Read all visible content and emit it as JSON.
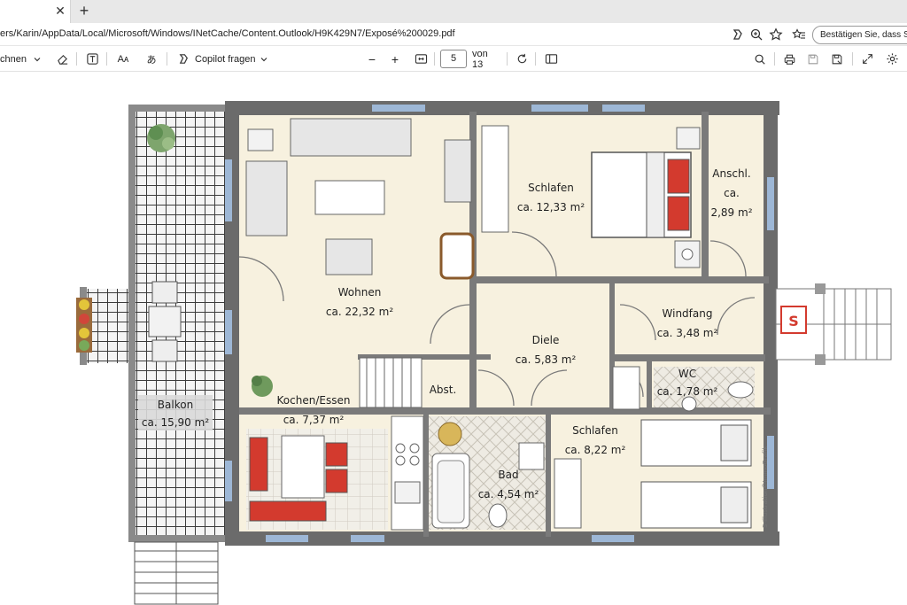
{
  "browser": {
    "tab": {
      "close_glyph": "✕"
    },
    "new_tab_glyph": "+",
    "address": {
      "url": "ers/Karin/AppData/Local/Microsoft/Windows/INetCache/Content.Outlook/H9K429N7/Exposé%200029.pdf",
      "confirm_pill": "Bestätigen Sie, dass Sie e"
    },
    "icons": [
      "copilot-icon",
      "zoom-icon",
      "star-icon",
      "favorites-icon"
    ]
  },
  "pdf_toolbar": {
    "draw_label": "chnen",
    "copilot_label": "Copilot fragen",
    "zoom_out": "−",
    "zoom_in": "+",
    "page_current": "5",
    "page_total_label": "von 13",
    "read_aloud_label": "Aᴀ",
    "translate_label": "あ"
  },
  "floorplan": {
    "rooms": {
      "wohnen": {
        "name": "Wohnen",
        "area": "ca. 22,32 m²"
      },
      "schlafen1": {
        "name": "Schlafen",
        "area": "ca. 12,33 m²"
      },
      "anschl": {
        "name": "Anschl.",
        "abbr": "ca.",
        "area": "2,89 m²"
      },
      "windfang": {
        "name": "Windfang",
        "area": "ca. 3,48 m²"
      },
      "diele": {
        "name": "Diele",
        "area": "ca. 5,83 m²"
      },
      "wc": {
        "name": "WC",
        "area": "ca. 1,78 m²"
      },
      "abst": {
        "name": "Abst."
      },
      "kochen": {
        "name": "Kochen/Essen",
        "area": "ca. 7,37 m²"
      },
      "bad": {
        "name": "Bad",
        "area": "ca. 4,54 m²"
      },
      "schlafen2": {
        "name": "Schlafen",
        "area": "ca. 8,22 m²"
      },
      "balkon": {
        "name": "Balkon",
        "area": "ca. 15,90 m²"
      }
    },
    "credit": "S-Illustration©ImmoGrafik",
    "colors": {
      "wall": "#6b6b6b",
      "floor": "#f7f1df",
      "tile": "#e4e0d6",
      "furniture": "#e6e6e6",
      "accent_red": "#d33a2e",
      "window": "#9db7d6"
    }
  }
}
